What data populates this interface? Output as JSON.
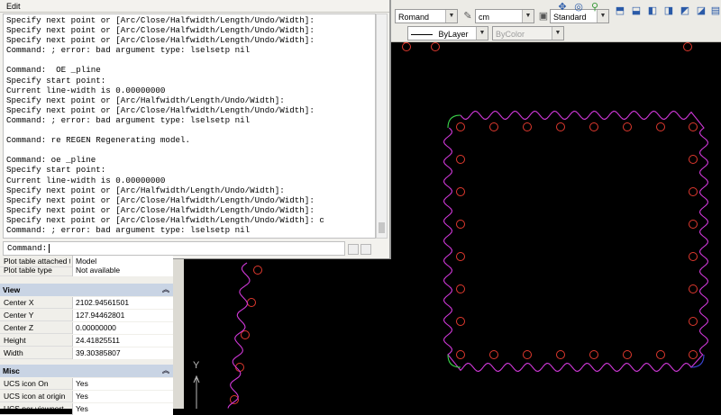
{
  "command_window": {
    "title": "Edit",
    "lines": [
      "Specify next point or [Arc/Close/Halfwidth/Length/Undo/Width]:",
      "Specify next point or [Arc/Close/Halfwidth/Length/Undo/Width]:",
      "Specify next point or [Arc/Close/Halfwidth/Length/Undo/Width]:",
      "Command: ; error: bad argument type: lselsetp nil",
      "",
      "Command:  OE _pline",
      "Specify start point:",
      "Current line-width is 0.00000000",
      "Specify next point or [Arc/Halfwidth/Length/Undo/Width]:",
      "Specify next point or [Arc/Close/Halfwidth/Length/Undo/Width]:",
      "Command: ; error: bad argument type: lselsetp nil",
      "",
      "Command: re REGEN Regenerating model.",
      "",
      "Command: oe _pline",
      "Specify start point:",
      "Current line-width is 0.00000000",
      "Specify next point or [Arc/Halfwidth/Length/Undo/Width]:",
      "Specify next point or [Arc/Close/Halfwidth/Length/Undo/Width]:",
      "Specify next point or [Arc/Close/Halfwidth/Length/Undo/Width]:",
      "Specify next point or [Arc/Close/Halfwidth/Length/Undo/Width]: c",
      "Command: ; error: bad argument type: lselsetp nil"
    ],
    "prompt": "Command:"
  },
  "toolbar": {
    "text_style": "Romand",
    "units": "cm",
    "dim_style": "Standard",
    "linetype": "ByLayer",
    "color": "ByColor"
  },
  "properties": {
    "rows_top": [
      {
        "key": "Plot table attached to",
        "value": "Model"
      },
      {
        "key": "Plot table type",
        "value": "Not available"
      }
    ],
    "view_section": "View",
    "view_rows": [
      {
        "key": "Center X",
        "value": "2102.94561501"
      },
      {
        "key": "Center Y",
        "value": "127.94462801"
      },
      {
        "key": "Center Z",
        "value": "0.00000000"
      },
      {
        "key": "Height",
        "value": "24.41825511"
      },
      {
        "key": "Width",
        "value": "39.30385807"
      }
    ],
    "misc_section": "Misc",
    "misc_rows": [
      {
        "key": "UCS icon On",
        "value": "Yes"
      },
      {
        "key": "UCS icon at origin",
        "value": "Yes"
      },
      {
        "key": "UCS per viewport",
        "value": "Yes"
      }
    ]
  },
  "drawing": {
    "ucs_axis_label": "Y",
    "colors": {
      "background": "#000000",
      "polyline": "#d038d8",
      "circles": "#e0392e",
      "corner_green": "#3ad24a",
      "corner_blue": "#3a46d6"
    },
    "icons": [
      "undo-icon",
      "redo-icon",
      "pan-icon",
      "orbit-icon",
      "zoom-icon",
      "text-style-icon",
      "dim-style-icon",
      "layer-icon"
    ]
  }
}
